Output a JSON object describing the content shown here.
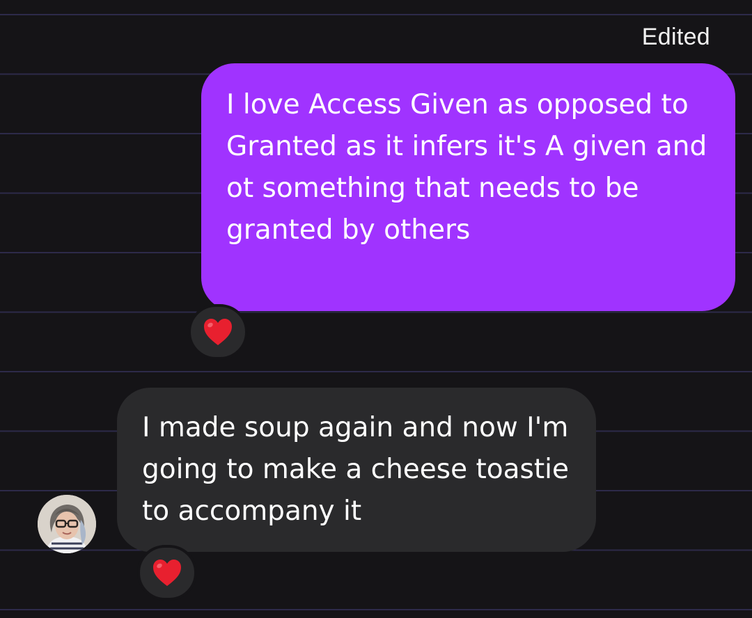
{
  "header": {
    "edited_label": "Edited"
  },
  "messages": [
    {
      "direction": "sent",
      "text": "I love Access Given as opposed to Granted as it infers it's A given and ot something that needs to be granted by others",
      "reaction": "red-heart"
    },
    {
      "direction": "received",
      "text": "I made soup again and now I'm going to make a cheese toastie to accompany it",
      "reaction": "red-heart"
    }
  ],
  "colors": {
    "background": "#151417",
    "rule_lines": "#2d2a4a",
    "sent_bubble": "#a033ff",
    "received_bubble": "#2a2a2c",
    "reaction_heart": "#e8202f"
  }
}
